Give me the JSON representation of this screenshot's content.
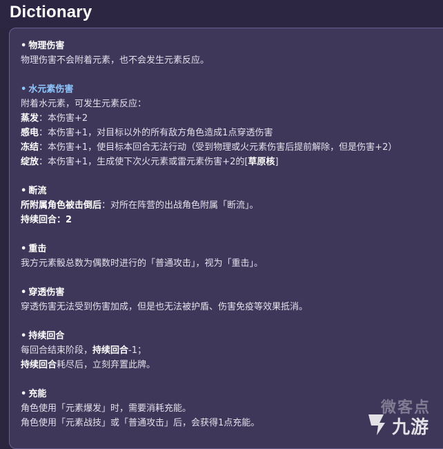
{
  "header": {
    "title": "Dictionary"
  },
  "sections": [
    {
      "title": "物理伤害",
      "lines": [
        "物理伤害不会附着元素，也不会发生元素反应。"
      ]
    },
    {
      "title": "水元素伤害",
      "lines": [
        "附着水元素，可发生元素反应：",
        {
          "label": "蒸发",
          "text": "：本伤害+2"
        },
        {
          "label": "感电",
          "text": "：本伤害+1，对目标以外的所有敌方角色造成1点穿透伤害"
        },
        {
          "label": "冻结",
          "text": "：本伤害+1，使目标本回合无法行动（受到物理或火元素伤害后提前解除，但是伤害+2）"
        },
        {
          "label": "绽放",
          "text": "：本伤害+1，生成使下次火元素或雷元素伤害+2的[",
          "bold_tail": "草原核",
          "tail": "]"
        }
      ]
    },
    {
      "title": "断流",
      "lines": [
        {
          "label": "所附属角色被击倒后",
          "text": "：对所在阵营的出战角色附属「断流」。"
        },
        {
          "label": "持续回合：2",
          "text": ""
        }
      ]
    },
    {
      "title": "重击",
      "lines": [
        "我方元素骰总数为偶数时进行的「普通攻击」，视为「重击」。"
      ]
    },
    {
      "title": "穿透伤害",
      "lines": [
        "穿透伤害无法受到伤害加成，但是也无法被护盾、伤害免疫等效果抵消。"
      ]
    },
    {
      "title": "持续回合",
      "lines": [
        {
          "pre": "每回合结束阶段，",
          "label": "持续回合",
          "text": "-1；"
        },
        {
          "label": "持续回合",
          "text": "耗尽后，立刻弃置此牌。"
        }
      ]
    },
    {
      "title": "充能",
      "lines": [
        "角色使用「元素爆发」时，需要消耗充能。",
        "角色使用「元素战技」或「普通攻击」后，会获得1点充能。"
      ]
    }
  ],
  "watermark": {
    "text1": "微客点",
    "text2": "九游"
  },
  "colors": {
    "background": "#2b2540",
    "panel": "#3e3759",
    "hydro": "#8fc8ff"
  }
}
